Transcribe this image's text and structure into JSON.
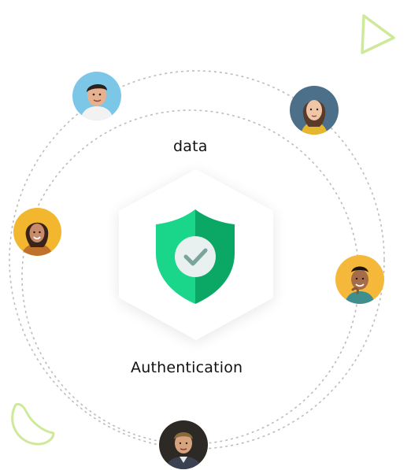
{
  "labels": {
    "top": "data",
    "bottom": "Authentication"
  },
  "colors": {
    "accent_green": "#00c27a",
    "shield_dark": "#0aa864",
    "shield_light": "#19d68a",
    "check_badge": "#e8f1f0",
    "check_mark": "#7aa39a",
    "orbit_dots": "#b9b9b9",
    "deco_lime": "#cfe99a"
  },
  "avatars": [
    {
      "name": "avatar-man-smiling-blue",
      "bg": "#7cc7e8"
    },
    {
      "name": "avatar-woman-brown-hair",
      "bg": "#4c6f8a"
    },
    {
      "name": "avatar-woman-yellow-bg",
      "bg": "#f2b72f"
    },
    {
      "name": "avatar-man-yellow-bg",
      "bg": "#f6b83a"
    },
    {
      "name": "avatar-man-suit-dark",
      "bg": "#2d2a26"
    }
  ]
}
